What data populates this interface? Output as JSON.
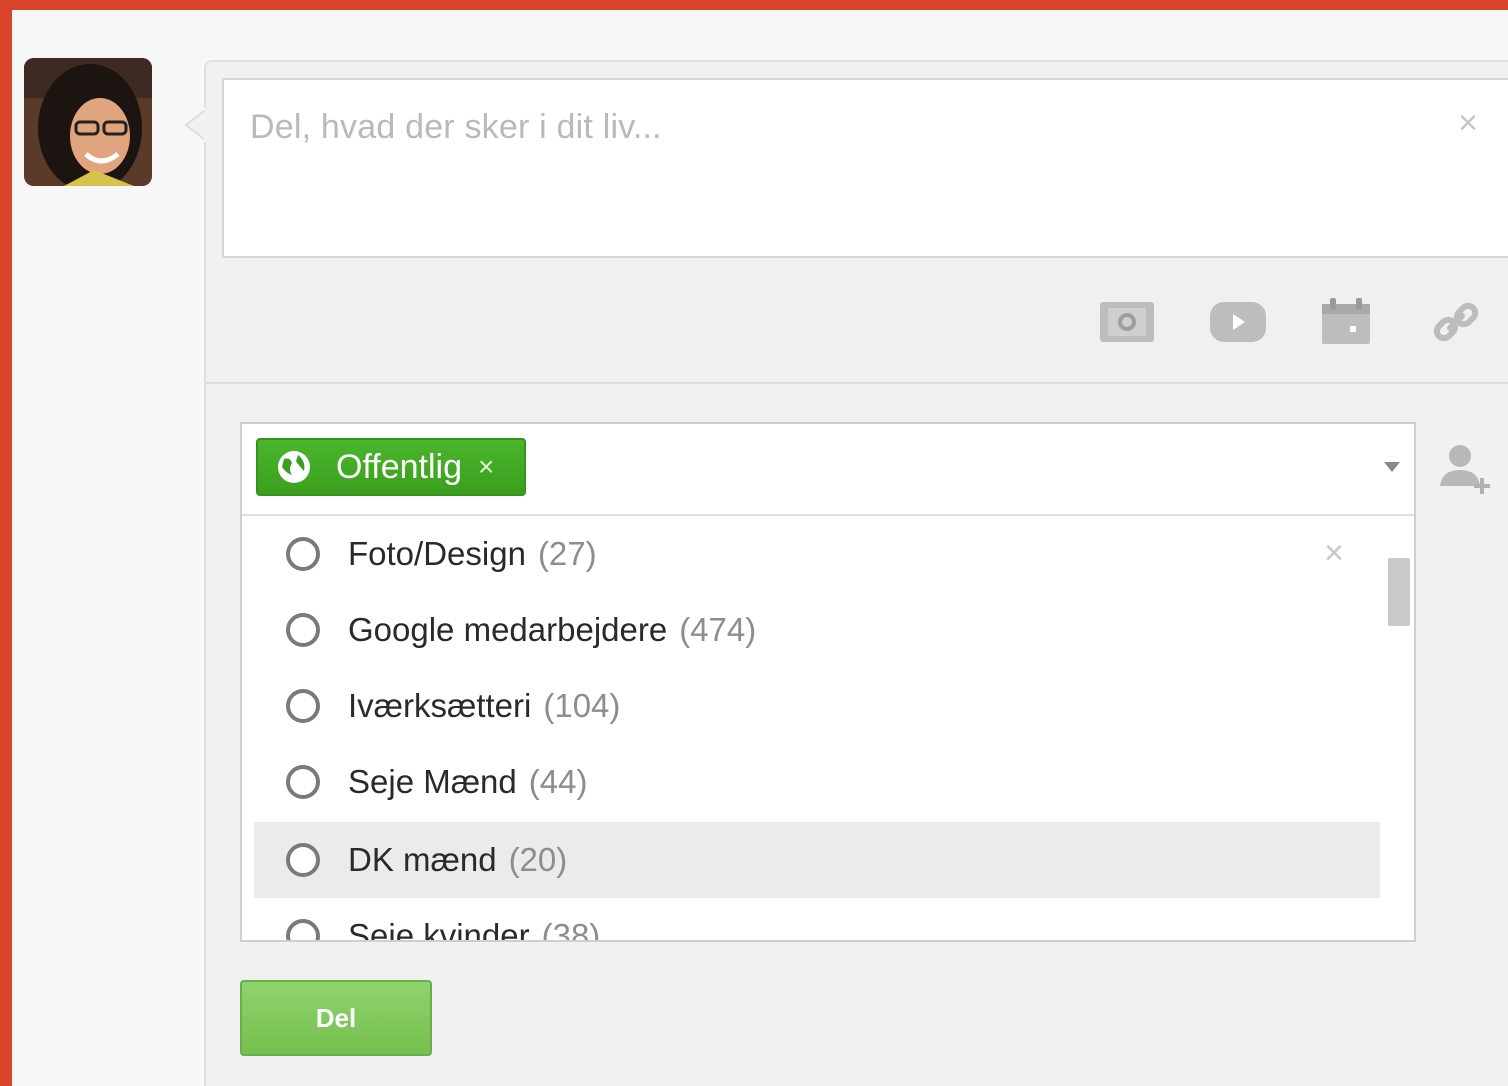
{
  "composer": {
    "placeholder": "Del, hvad der sker i dit liv...",
    "clear_label": "×"
  },
  "toolbar": {
    "tools": [
      {
        "icon": "camera-icon"
      },
      {
        "icon": "video-icon"
      },
      {
        "icon": "calendar-icon"
      },
      {
        "icon": "link-icon"
      }
    ]
  },
  "audience": {
    "chip_label": "Offentlig",
    "chip_remove": "×",
    "list_close": "×",
    "circles": [
      {
        "name": "Foto/Design",
        "count": "(27)"
      },
      {
        "name": "Google medarbejdere",
        "count": "(474)"
      },
      {
        "name": "Iværksætteri",
        "count": "(104)"
      },
      {
        "name": "Seje Mænd",
        "count": "(44)"
      },
      {
        "name": "DK mænd",
        "count": "(20)"
      },
      {
        "name": "Seje kvinder",
        "count": "(38)"
      }
    ]
  },
  "actions": {
    "share_label": "Del"
  },
  "colors": {
    "background": "#d9432b",
    "chip_green": "#3a9f1f",
    "share_green": "#74c04f"
  }
}
